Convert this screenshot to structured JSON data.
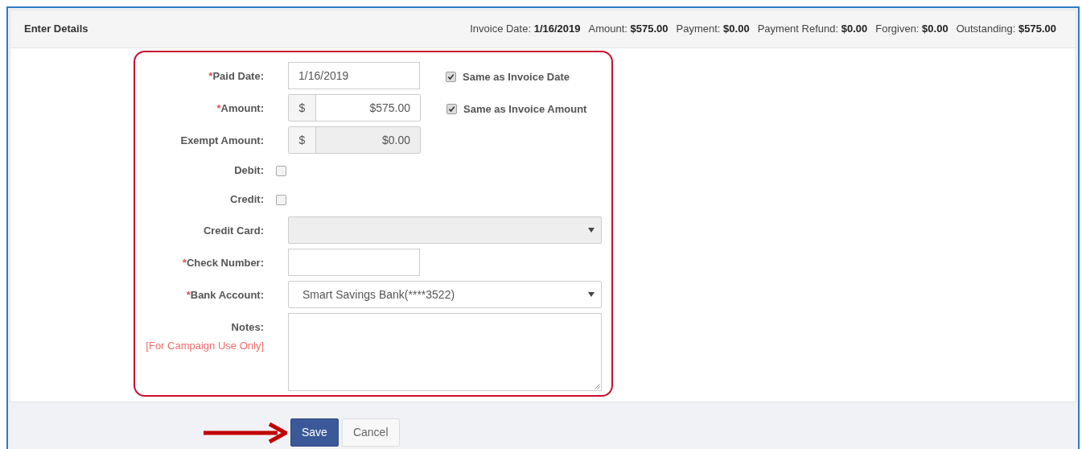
{
  "panel": {
    "title": "Enter Details",
    "summary": [
      {
        "label": "Invoice Date:",
        "value": "1/16/2019"
      },
      {
        "label": "Amount:",
        "value": "$575.00"
      },
      {
        "label": "Payment:",
        "value": "$0.00"
      },
      {
        "label": "Payment Refund:",
        "value": "$0.00"
      },
      {
        "label": "Forgiven:",
        "value": "$0.00"
      },
      {
        "label": "Outstanding:",
        "value": "$575.00"
      }
    ]
  },
  "form": {
    "fields": [
      {
        "kind": "text",
        "marker": "*",
        "label": "Paid Date:",
        "value": "1/16/2019",
        "side_checkbox": {
          "label": "Same as Invoice Date",
          "checked": true
        }
      },
      {
        "kind": "money",
        "marker": "*",
        "label": "Amount:",
        "prefix": "$",
        "value": "$575.00",
        "disabled": false,
        "side_checkbox": {
          "label": "Same as Invoice Amount",
          "checked": true
        }
      },
      {
        "kind": "money",
        "label": "Exempt Amount:",
        "prefix": "$",
        "value": "$0.00",
        "disabled": true
      },
      {
        "kind": "checkbox",
        "label": "Debit:",
        "checked": false
      },
      {
        "kind": "checkbox",
        "label": "Credit:",
        "checked": false
      },
      {
        "kind": "select",
        "label": "Credit Card:",
        "disabled": true
      },
      {
        "kind": "text",
        "marker": "*",
        "label": "Check Number:"
      },
      {
        "kind": "select",
        "marker": "*",
        "label": "Bank Account:",
        "value": "Smart Savings Bank(****3522)",
        "disabled": false
      },
      {
        "kind": "textarea",
        "label": "Notes:",
        "note": "[For Campaign Use Only]"
      }
    ]
  },
  "buttons": [
    {
      "label": "Save",
      "primary": true
    },
    {
      "label": "Cancel",
      "primary": false
    }
  ]
}
